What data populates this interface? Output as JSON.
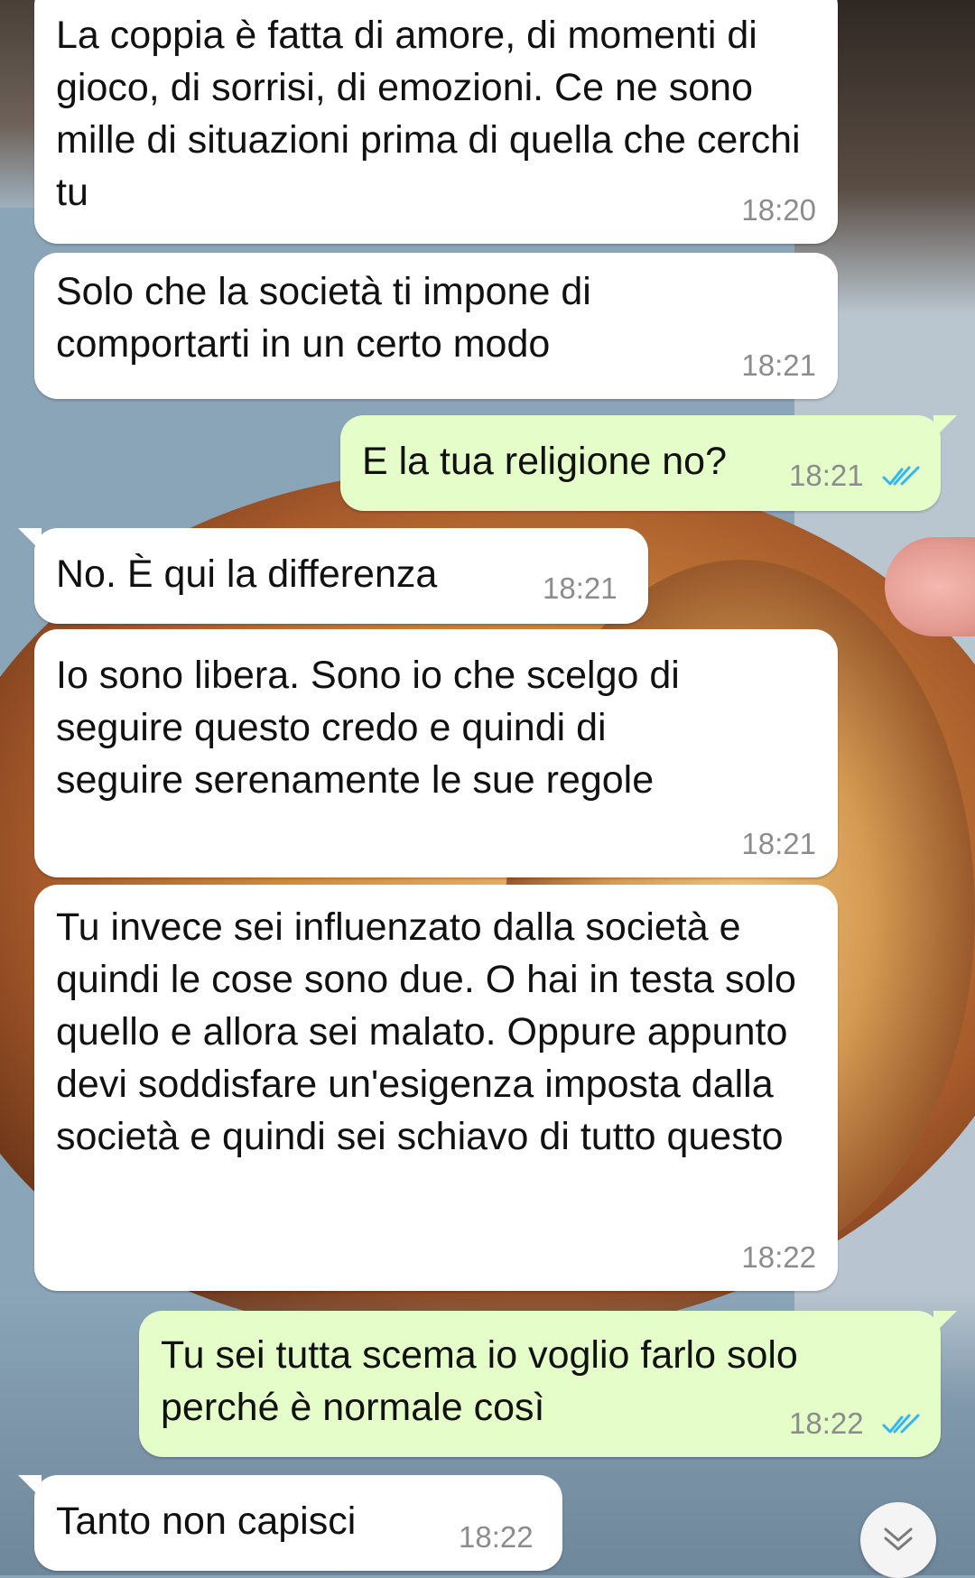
{
  "messages": [
    {
      "direction": "in",
      "text": "La coppia è fatta di amore, di momenti di gioco, di sorrisi, di emozioni. Ce ne sono mille di situazioni prima di quella che cerchi tu",
      "time": "18:20"
    },
    {
      "direction": "in",
      "text": "Solo che la società ti impone di comportarti in un certo modo",
      "time": "18:21"
    },
    {
      "direction": "out",
      "text": "E la tua religione no?",
      "time": "18:21",
      "status": "read"
    },
    {
      "direction": "in",
      "text": "No. È qui la differenza",
      "time": "18:21"
    },
    {
      "direction": "in",
      "text": "Io sono libera. Sono io che scelgo di seguire questo credo e quindi di seguire serenamente le sue regole",
      "time": "18:21"
    },
    {
      "direction": "in",
      "text": "Tu invece sei influenzato dalla società e quindi le cose sono due. O hai in testa solo quello e allora sei malato. Oppure appunto devi soddisfare un'esigenza imposta dalla società e quindi sei schiavo di tutto questo",
      "time": "18:22"
    },
    {
      "direction": "out",
      "text": "Tu sei tutta scema io voglio farlo solo perché è normale così",
      "time": "18:22",
      "status": "read"
    },
    {
      "direction": "in",
      "text": "Tanto non capisci",
      "time": "18:22"
    }
  ],
  "colors": {
    "incoming": "#ffffff",
    "outgoing": "#e4fdc9",
    "read_ticks": "#34b7f1",
    "timestamp": "#8c8c8c"
  },
  "icons": {
    "read_receipt": "double-check-icon",
    "scroll_down": "chevron-double-down-icon"
  }
}
